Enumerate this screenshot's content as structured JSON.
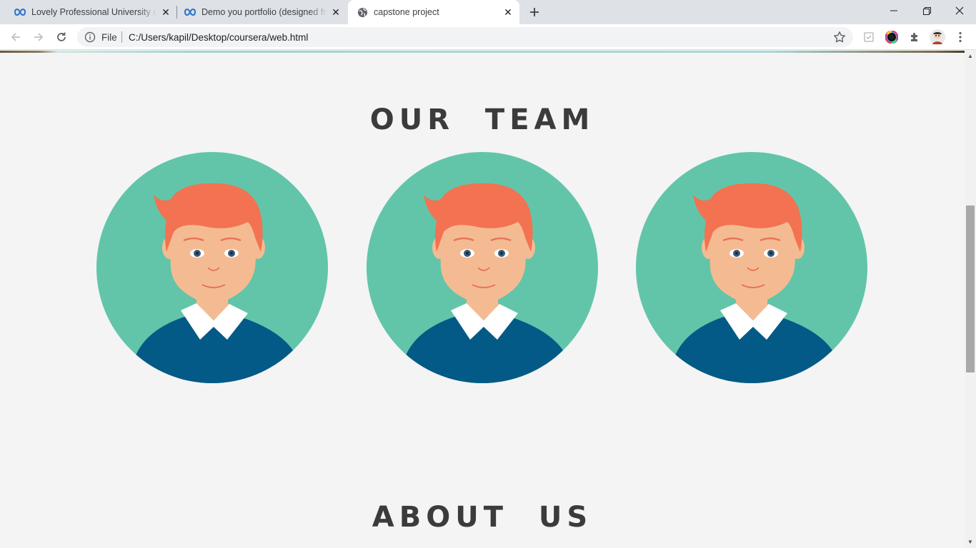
{
  "tabs": [
    {
      "title": "Lovely Professional University on",
      "icon": "coursera-infinity-icon",
      "active": false
    },
    {
      "title": "Demo you portfolio (designed fro",
      "icon": "coursera-infinity-icon",
      "active": false
    },
    {
      "title": "capstone project",
      "icon": "globe-icon",
      "active": true
    }
  ],
  "address_bar": {
    "scheme_label": "File",
    "url": "C:/Users/kapil/Desktop/coursera/web.html"
  },
  "page": {
    "team_heading": "OUR TEAM",
    "about_heading": "ABOUT US",
    "team_members": [
      {
        "avatar": "male-avatar-illustration"
      },
      {
        "avatar": "male-avatar-illustration"
      },
      {
        "avatar": "male-avatar-illustration"
      }
    ]
  },
  "colors": {
    "avatar_bg": "#62c5aa",
    "hair": "#f37251",
    "skin": "#f4bb92",
    "shirt": "#035a86",
    "heading_text": "#3b3b3b"
  }
}
